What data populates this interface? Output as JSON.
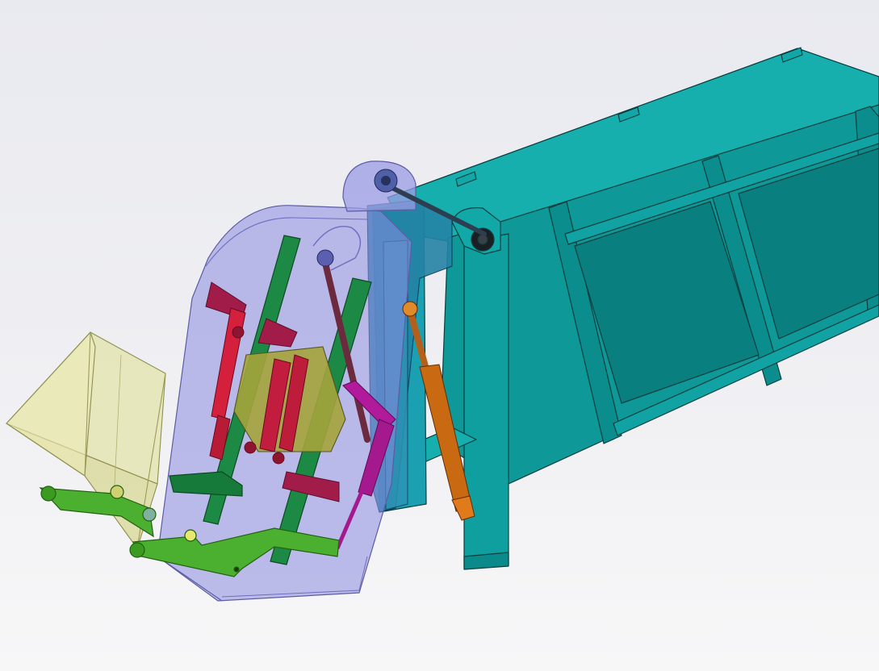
{
  "viewport": {
    "background_top": "#e9eaf0",
    "background_bottom": "#f7f7f8"
  },
  "model": {
    "parts": [
      {
        "name": "compactor-body",
        "color": "#0f9f9f"
      },
      {
        "name": "tailgate-housing",
        "color": "#8c8ce0"
      },
      {
        "name": "feed-hopper",
        "color": "#d9d99a"
      },
      {
        "name": "rear-frame-posts",
        "color": "#2c84a8"
      },
      {
        "name": "slide-guide-rails",
        "color": "#157a3b"
      },
      {
        "name": "packer-plate-cylinders",
        "color": "#c81e3c"
      },
      {
        "name": "packer-blade",
        "color": "#9a1f47"
      },
      {
        "name": "carriage-plate",
        "color": "#a2a33b"
      },
      {
        "name": "sweep-cylinder",
        "color": "#b01a9b"
      },
      {
        "name": "tailgate-lift-cylinder",
        "color": "#c96a12"
      },
      {
        "name": "hinge-shaft",
        "color": "#2c3e50"
      },
      {
        "name": "lifter-arms",
        "color": "#3fa32a"
      },
      {
        "name": "guide-link",
        "color": "#6b2a3d"
      }
    ]
  }
}
